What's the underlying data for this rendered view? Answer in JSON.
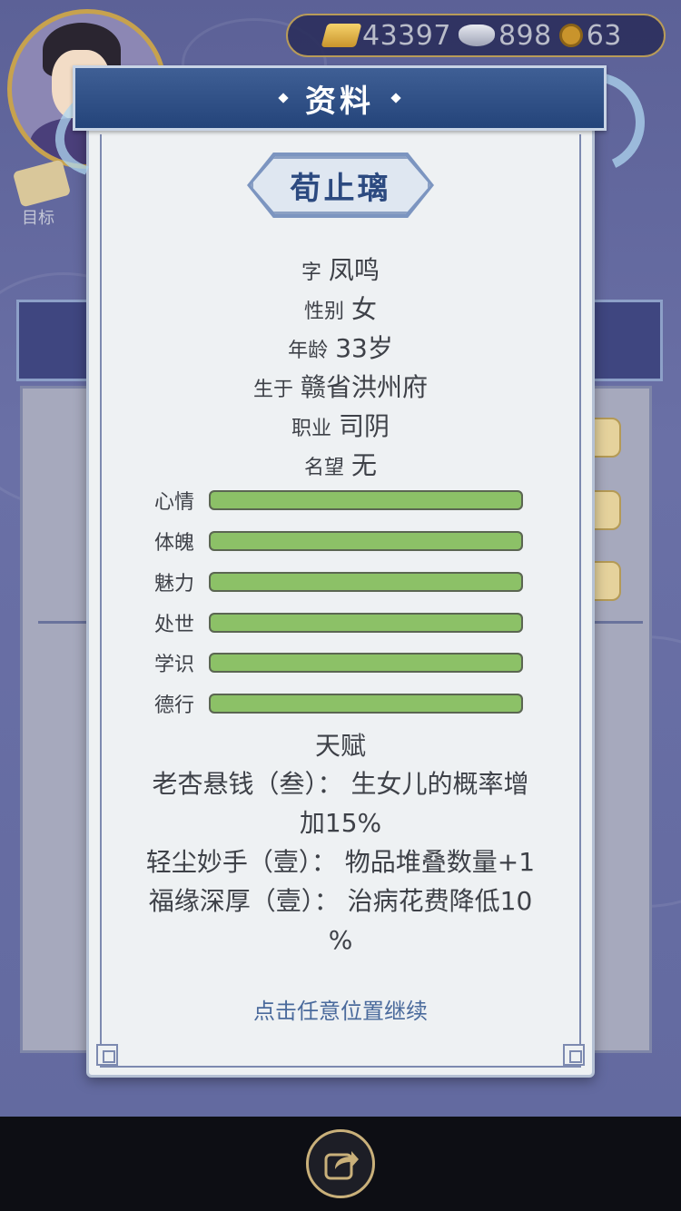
{
  "resources": {
    "gold": "43397",
    "silver": "898",
    "coins": "63"
  },
  "background": {
    "goal_label": "目标"
  },
  "dialog": {
    "title": "资料",
    "name": "荀止璃",
    "info": [
      {
        "key": "字",
        "value": "凤鸣"
      },
      {
        "key": "性别",
        "value": "女"
      },
      {
        "key": "年龄",
        "value": "33岁"
      },
      {
        "key": "生于",
        "value": "赣省洪州府"
      },
      {
        "key": "职业",
        "value": "司阴"
      },
      {
        "key": "名望",
        "value": "无"
      }
    ],
    "stats": [
      {
        "label": "心情",
        "level": 1.0
      },
      {
        "label": "体魄",
        "level": 1.0
      },
      {
        "label": "魅力",
        "level": 1.0
      },
      {
        "label": "处世",
        "level": 1.0
      },
      {
        "label": "学识",
        "level": 1.0
      },
      {
        "label": "德行",
        "level": 1.0
      }
    ],
    "talent_title": "天赋",
    "talents": [
      {
        "line1": "老杏悬钱（叁）： 生女儿的概率增",
        "line2": "加15%"
      },
      {
        "line1": "轻尘妙手（壹）： 物品堆叠数量+1",
        "line2": ""
      },
      {
        "line1": "福缘深厚（壹）： 治病花费降低10",
        "line2": "%"
      }
    ],
    "continue_hint": "点击任意位置继续"
  },
  "colors": {
    "stat_fill": "#8cc167",
    "banner": "#24447a",
    "name_text": "#2c4a80"
  }
}
